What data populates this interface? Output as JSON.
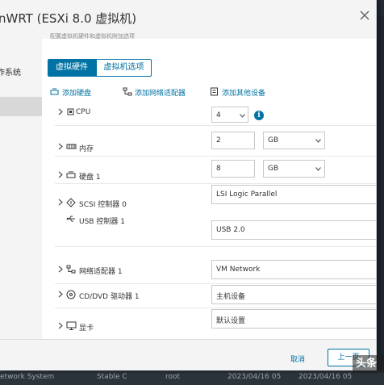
{
  "modal": {
    "title": "nWRT (ESXi 8.0 虚拟机)",
    "subtitle": "配置虚拟机硬件和虚拟机附加选项"
  },
  "left_nav": {
    "steps": [
      {
        "label": "作系统",
        "active": false
      },
      {
        "label": "",
        "active": true
      }
    ]
  },
  "tabs": [
    {
      "label": "虚拟硬件",
      "selected": true
    },
    {
      "label": "虚拟机选项",
      "selected": false
    }
  ],
  "toolbar": {
    "add_disk": "添加硬盘",
    "add_nic": "添加网络适配器",
    "add_other": "添加其他设备"
  },
  "hardware": {
    "cpu": {
      "label": "CPU",
      "value": "4"
    },
    "memory": {
      "label": "内存",
      "value": "2",
      "unit": "GB"
    },
    "disk": {
      "label": "硬盘 1",
      "value": "8",
      "unit": "GB"
    },
    "scsi": {
      "label": "SCSI 控制器 0",
      "value": "LSI Logic Parallel"
    },
    "usb": {
      "label": "USB 控制器 1",
      "value": "USB 2.0"
    },
    "nic": {
      "label": "网络适配器 1",
      "value": "VM Network"
    },
    "cdrom": {
      "label": "CD/DVD 驱动器 1",
      "value": "主机设备"
    },
    "video": {
      "label": "显卡",
      "value": "默认设置"
    }
  },
  "footer": {
    "cancel": "取消",
    "back": "上一页"
  },
  "background_row": {
    "c1": "etwork System",
    "c2": "Stable C",
    "c3": "root",
    "c4": "2023/04/16 05",
    "c5": "2023/04/16 05"
  },
  "watermark": "头条",
  "colors": {
    "accent": "#0072a3",
    "modal_bg": "#f4f4f4",
    "backdrop": "#1f2730"
  }
}
